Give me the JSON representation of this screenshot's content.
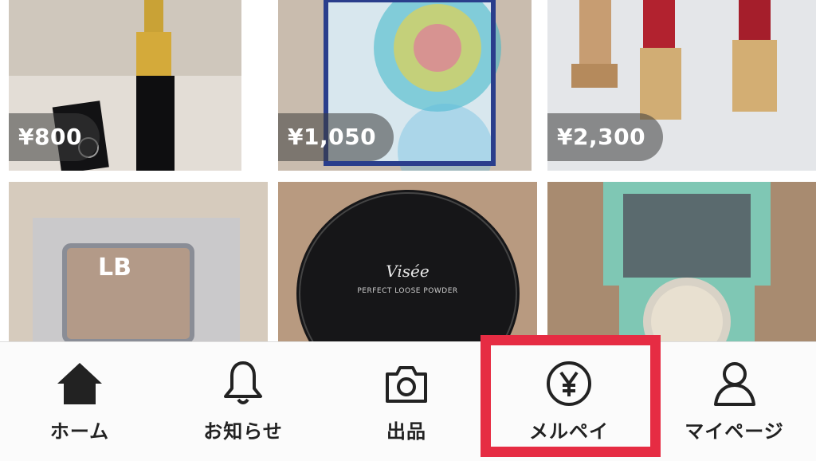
{
  "products": [
    {
      "price": "¥800"
    },
    {
      "price": "¥1,050"
    },
    {
      "price": "¥2,300"
    },
    {
      "price": ""
    },
    {
      "price": ""
    },
    {
      "price": ""
    }
  ],
  "product_text": {
    "lb_logo": "LB",
    "visee_brand": "Visée",
    "visee_subtitle": "PERFECT LOOSE POWDER"
  },
  "nav": {
    "home": "ホーム",
    "notifications": "お知らせ",
    "sell": "出品",
    "merpay": "メルペイ",
    "mypage": "マイページ"
  },
  "colors": {
    "highlight": "#e62c43",
    "nav_background": "#fbfbfb",
    "icon": "#222222"
  }
}
